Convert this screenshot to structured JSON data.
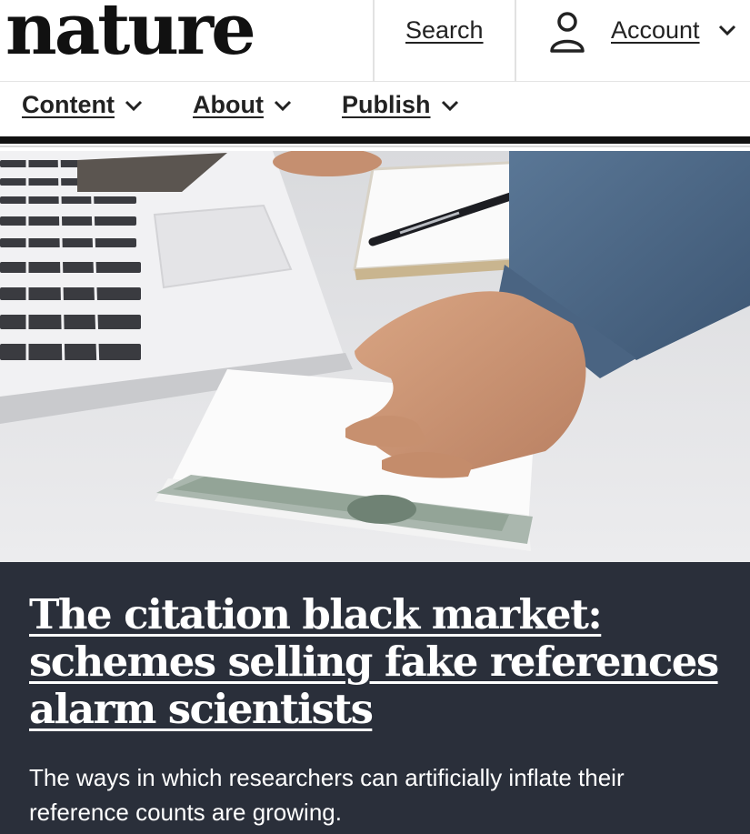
{
  "header": {
    "logo": "nature",
    "search_label": "Search",
    "account_label": "Account"
  },
  "nav": {
    "items": [
      {
        "label": "Content"
      },
      {
        "label": "About"
      },
      {
        "label": "Publish"
      }
    ]
  },
  "hero": {
    "image_alt": "Hand placing an envelope of dollar banknotes next to a laptop and notebook"
  },
  "article": {
    "headline": "The citation black market: schemes selling fake references alarm scientists",
    "standfirst": "The ways in which researchers can artificially inflate their reference counts are growing."
  },
  "colors": {
    "panel_bg": "#2a2f3a",
    "text_dark": "#111111",
    "text_light": "#ffffff"
  }
}
